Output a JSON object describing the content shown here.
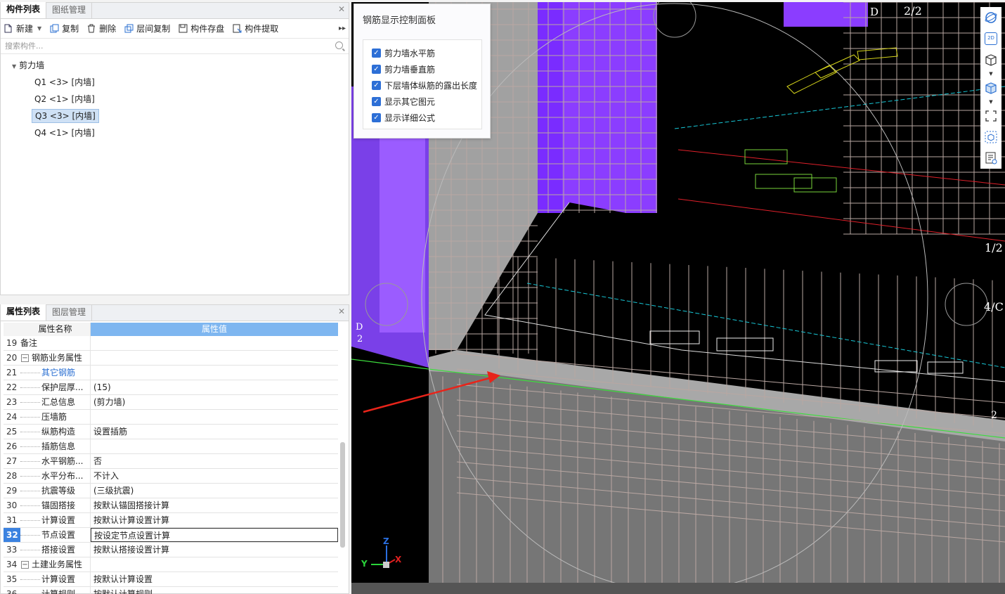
{
  "component_panel": {
    "tabs": [
      "构件列表",
      "图纸管理"
    ],
    "toolbar": [
      {
        "label": "新建",
        "icon": "new-doc-icon"
      },
      {
        "label": "复制",
        "icon": "copy-icon"
      },
      {
        "label": "删除",
        "icon": "trash-icon"
      },
      {
        "label": "层间复制",
        "icon": "layer-copy-icon"
      },
      {
        "label": "构件存盘",
        "icon": "save-component-icon"
      },
      {
        "label": "构件提取",
        "icon": "extract-component-icon"
      }
    ],
    "search_placeholder": "搜索构件...",
    "tree": {
      "root": "剪力墙",
      "items": [
        "Q1 <3> [内墙]",
        "Q2 <1> [内墙]",
        "Q3 <3> [内墙]",
        "Q4 <1> [内墙]"
      ],
      "selected_index": 2
    }
  },
  "property_panel": {
    "tabs": [
      "属性列表",
      "图层管理"
    ],
    "header": {
      "name": "属性名称",
      "value": "属性值"
    },
    "rows": [
      {
        "num": "19",
        "name": "备注",
        "value": "",
        "level": 0
      },
      {
        "num": "20",
        "name": "钢筋业务属性",
        "value": "",
        "level": 0,
        "group": true
      },
      {
        "num": "21",
        "name": "其它钢筋",
        "value": "",
        "level": 1,
        "blue": true
      },
      {
        "num": "22",
        "name": "保护层厚...",
        "value": "(15)",
        "level": 1
      },
      {
        "num": "23",
        "name": "汇总信息",
        "value": "(剪力墙)",
        "level": 1
      },
      {
        "num": "24",
        "name": "压墙筋",
        "value": "",
        "level": 1
      },
      {
        "num": "25",
        "name": "纵筋构造",
        "value": "设置插筋",
        "level": 1
      },
      {
        "num": "26",
        "name": "插筋信息",
        "value": "",
        "level": 1
      },
      {
        "num": "27",
        "name": "水平钢筋...",
        "value": "否",
        "level": 1
      },
      {
        "num": "28",
        "name": "水平分布...",
        "value": "不计入",
        "level": 1
      },
      {
        "num": "29",
        "name": "抗震等级",
        "value": "(三级抗震)",
        "level": 1
      },
      {
        "num": "30",
        "name": "锚固搭接",
        "value": "按默认锚固搭接计算",
        "level": 1
      },
      {
        "num": "31",
        "name": "计算设置",
        "value": "按默认计算设置计算",
        "level": 1
      },
      {
        "num": "32",
        "name": "节点设置",
        "value": "按设定节点设置计算",
        "level": 1,
        "current": true
      },
      {
        "num": "33",
        "name": "搭接设置",
        "value": "按默认搭接设置计算",
        "level": 1
      },
      {
        "num": "34",
        "name": "土建业务属性",
        "value": "",
        "level": 0,
        "group": true
      },
      {
        "num": "35",
        "name": "计算设置",
        "value": "按默认计算设置",
        "level": 1
      },
      {
        "num": "36",
        "name": "计算规则",
        "value": "按默认计算规则",
        "level": 1
      }
    ]
  },
  "control_panel": {
    "title": "钢筋显示控制面板",
    "options": [
      {
        "label": "剪力墙水平筋",
        "checked": true
      },
      {
        "label": "剪力墙垂直筋",
        "checked": true
      },
      {
        "label": "下层墙体纵筋的露出长度",
        "checked": true
      },
      {
        "label": "显示其它图元",
        "checked": true
      },
      {
        "label": "显示详细公式",
        "checked": true
      }
    ]
  },
  "viewport": {
    "labels": {
      "grid_d": "D",
      "grid_22": "2/2",
      "grid_12": "1/2",
      "grid_4c": "4/C",
      "grid_d2_top": "D",
      "grid_d2_bottom": "2",
      "grid_2": "2"
    },
    "axes": {
      "x": "X",
      "y": "Y",
      "z": "Z"
    },
    "colors": {
      "wall_purple": "#7a2cff",
      "rebar": "#b9a7a2",
      "wall_gray": "#8a8a8a",
      "arrow_red": "#e8241a"
    }
  },
  "right_tools": [
    "orbit-icon",
    "2d-view-icon",
    "3d-box-icon",
    "solid-box-icon",
    "fullscreen-icon",
    "component-box-icon",
    "report-view-icon"
  ]
}
